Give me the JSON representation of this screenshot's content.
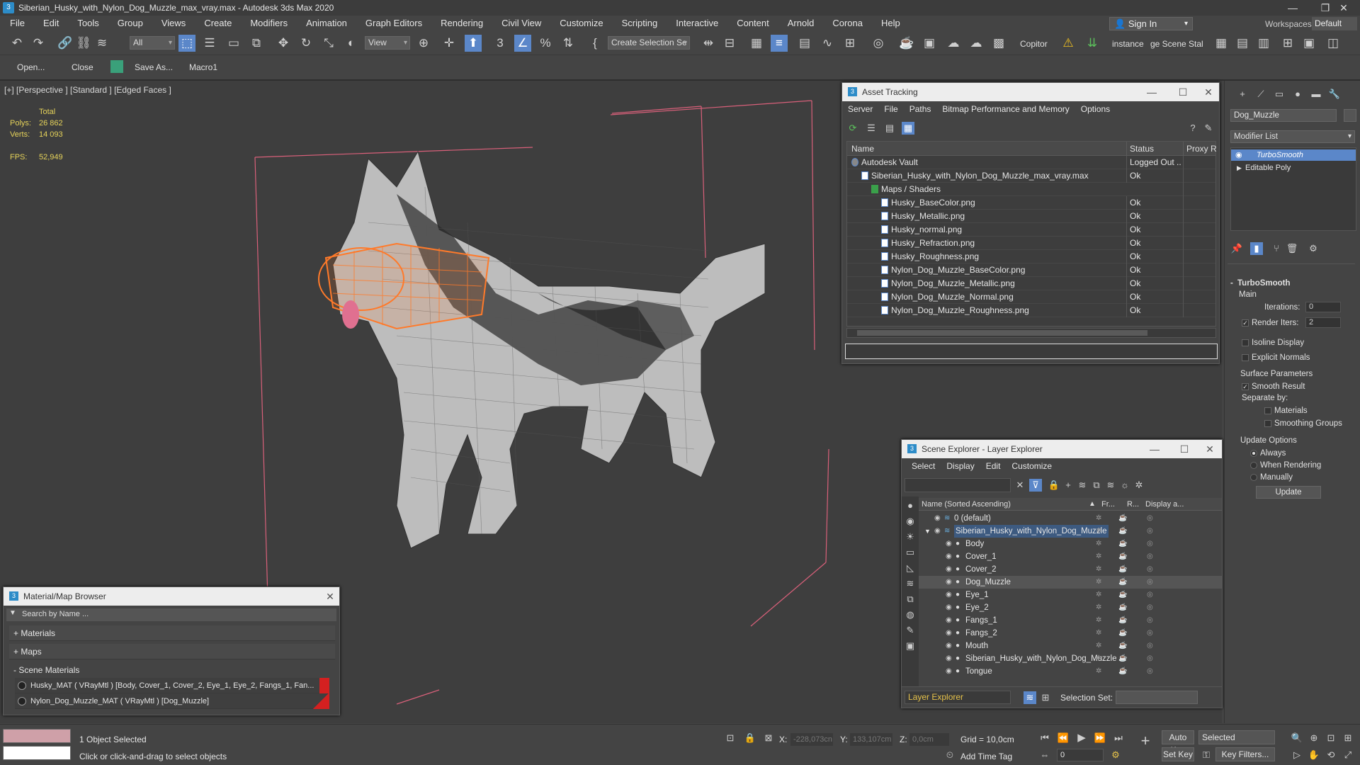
{
  "window": {
    "title": "Siberian_Husky_with_Nylon_Dog_Muzzle_max_vray.max - Autodesk 3ds Max 2020"
  },
  "menu": [
    "File",
    "Edit",
    "Tools",
    "Group",
    "Views",
    "Create",
    "Modifiers",
    "Animation",
    "Graph Editors",
    "Rendering",
    "Civil View",
    "Customize",
    "Scripting",
    "Interactive",
    "Content",
    "Arnold",
    "Corona",
    "Help"
  ],
  "account": {
    "signin": "Sign In",
    "workspaces_label": "Workspaces:",
    "workspace": "Default"
  },
  "toolbar": {
    "filter": "All",
    "ref_coord": "View",
    "selection_set": "Create Selection Se",
    "copitor": "Copitor",
    "instance": "instance",
    "scene_state": "ge Scene Stal"
  },
  "toolbar2": {
    "open": "Open...",
    "close": "Close",
    "saveas": "Save As...",
    "macro": "Macro1"
  },
  "viewport": {
    "label": "[+] [Perspective ] [Standard ] [Edged Faces ]",
    "stats": {
      "total_label": "Total",
      "polys_label": "Polys:",
      "polys": "26 862",
      "verts_label": "Verts:",
      "verts": "14 093",
      "fps_label": "FPS:",
      "fps": "52,949"
    }
  },
  "asset_tracking": {
    "title": "Asset Tracking",
    "menu": [
      "Server",
      "File",
      "Paths",
      "Bitmap Performance and Memory",
      "Options"
    ],
    "columns": [
      "Name",
      "Status",
      "Proxy Re"
    ],
    "rows": [
      {
        "name": "Autodesk Vault",
        "status": "Logged Out ...",
        "indent": 0
      },
      {
        "name": "Siberian_Husky_with_Nylon_Dog_Muzzle_max_vray.max",
        "status": "Ok",
        "indent": 1
      },
      {
        "name": "Maps / Shaders",
        "status": "",
        "indent": 2
      },
      {
        "name": "Husky_BaseColor.png",
        "status": "Ok",
        "indent": 3
      },
      {
        "name": "Husky_Metallic.png",
        "status": "Ok",
        "indent": 3
      },
      {
        "name": "Husky_normal.png",
        "status": "Ok",
        "indent": 3
      },
      {
        "name": "Husky_Refraction.png",
        "status": "Ok",
        "indent": 3
      },
      {
        "name": "Husky_Roughness.png",
        "status": "Ok",
        "indent": 3
      },
      {
        "name": "Nylon_Dog_Muzzle_BaseColor.png",
        "status": "Ok",
        "indent": 3
      },
      {
        "name": "Nylon_Dog_Muzzle_Metallic.png",
        "status": "Ok",
        "indent": 3
      },
      {
        "name": "Nylon_Dog_Muzzle_Normal.png",
        "status": "Ok",
        "indent": 3
      },
      {
        "name": "Nylon_Dog_Muzzle_Roughness.png",
        "status": "Ok",
        "indent": 3
      }
    ]
  },
  "scene_explorer": {
    "title": "Scene Explorer - Layer Explorer",
    "menu": [
      "Select",
      "Display",
      "Edit",
      "Customize"
    ],
    "columns": [
      "Name (Sorted Ascending)",
      "Fr...",
      "R...",
      "Display a..."
    ],
    "rows": [
      {
        "name": "0 (default)",
        "level": 0,
        "selected": false
      },
      {
        "name": "Siberian_Husky_with_Nylon_Dog_Muzzle",
        "level": 0,
        "selected": false
      },
      {
        "name": "Body",
        "level": 1,
        "selected": false
      },
      {
        "name": "Cover_1",
        "level": 1,
        "selected": false
      },
      {
        "name": "Cover_2",
        "level": 1,
        "selected": false
      },
      {
        "name": "Dog_Muzzle",
        "level": 1,
        "selected": true
      },
      {
        "name": "Eye_1",
        "level": 1,
        "selected": false
      },
      {
        "name": "Eye_2",
        "level": 1,
        "selected": false
      },
      {
        "name": "Fangs_1",
        "level": 1,
        "selected": false
      },
      {
        "name": "Fangs_2",
        "level": 1,
        "selected": false
      },
      {
        "name": "Mouth",
        "level": 1,
        "selected": false
      },
      {
        "name": "Siberian_Husky_with_Nylon_Dog_Muzzle",
        "level": 1,
        "selected": false
      },
      {
        "name": "Tongue",
        "level": 1,
        "selected": false
      }
    ],
    "footer_layer": "Layer Explorer",
    "selection_set_label": "Selection Set:"
  },
  "material_browser": {
    "title": "Material/Map Browser",
    "search_placeholder": "Search by Name ...",
    "sections": [
      "+ Materials",
      "+ Maps",
      "- Scene Materials"
    ],
    "materials": [
      "Husky_MAT  ( VRayMtl )  [Body, Cover_1, Cover_2, Eye_1, Eye_2, Fangs_1, Fan...",
      "Nylon_Dog_Muzzle_MAT  ( VRayMtl )  [Dog_Muzzle]"
    ]
  },
  "command_panel": {
    "object_name": "Dog_Muzzle",
    "modifier_list": "Modifier List",
    "stack": [
      "TurboSmooth",
      "Editable Poly"
    ],
    "rollout_title": "TurboSmooth",
    "main_label": "Main",
    "iterations_label": "Iterations:",
    "iterations": "0",
    "render_iters_label": "Render Iters:",
    "render_iters": "2",
    "isoline": "Isoline Display",
    "explicit": "Explicit Normals",
    "surface_params": "Surface Parameters",
    "smooth_result": "Smooth Result",
    "separate_by": "Separate by:",
    "materials": "Materials",
    "smoothing_groups": "Smoothing Groups",
    "update_options": "Update Options",
    "always": "Always",
    "when_rendering": "When Rendering",
    "manually": "Manually",
    "update_btn": "Update"
  },
  "status_bar": {
    "selected": "1 Object Selected",
    "prompt": "Click or click-and-drag to select objects",
    "x_label": "X:",
    "x": "-228,073cn",
    "y_label": "Y:",
    "y": "133,107cm",
    "z_label": "Z:",
    "z": "0,0cm",
    "grid": "Grid = 10,0cm",
    "add_time_tag": "Add Time Tag",
    "auto_key": "Auto Key",
    "set_key": "Set Key",
    "key_mode": "Selected",
    "key_filters": "Key Filters...",
    "frame": "0"
  }
}
